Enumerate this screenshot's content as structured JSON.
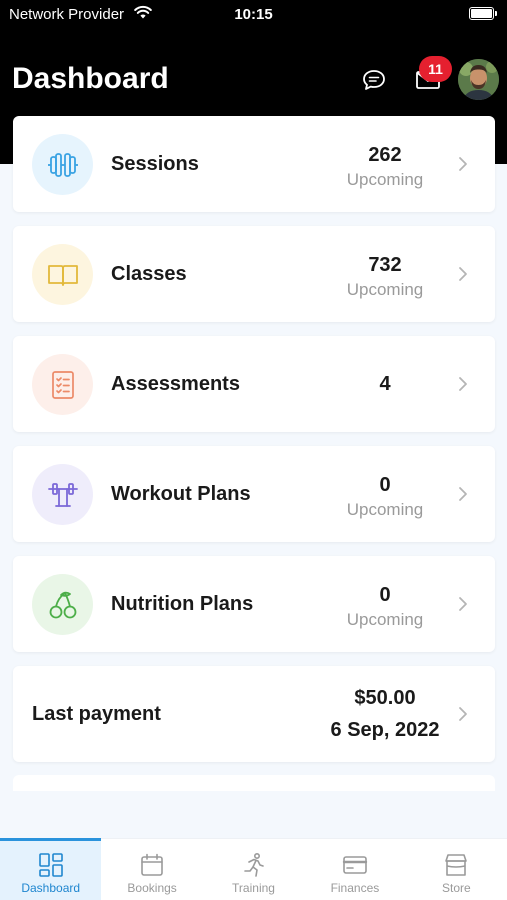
{
  "status_bar": {
    "carrier": "Network Provider",
    "time": "10:15"
  },
  "header": {
    "title": "Dashboard",
    "notification_count": "11",
    "chat_icon": "chat-bubble-icon",
    "mail_icon": "mail-icon"
  },
  "cards": [
    {
      "label": "Sessions",
      "value": "262",
      "sub": "Upcoming",
      "icon": "dumbbell-icon",
      "icon_bg": "#e6f4fd",
      "icon_color": "#3aa3e3"
    },
    {
      "label": "Classes",
      "value": "732",
      "sub": "Upcoming",
      "icon": "book-icon",
      "icon_bg": "#fdf5df",
      "icon_color": "#e2b93b"
    },
    {
      "label": "Assessments",
      "value": "4",
      "sub": "",
      "icon": "checklist-icon",
      "icon_bg": "#fdefea",
      "icon_color": "#ec8a68"
    },
    {
      "label": "Workout Plans",
      "value": "0",
      "sub": "Upcoming",
      "icon": "barbell-icon",
      "icon_bg": "#efedfb",
      "icon_color": "#7b68d8"
    },
    {
      "label": "Nutrition Plans",
      "value": "0",
      "sub": "Upcoming",
      "icon": "cherries-icon",
      "icon_bg": "#e9f6e7",
      "icon_color": "#4cae48"
    }
  ],
  "payment": {
    "label": "Last payment",
    "amount": "$50.00",
    "date": "6 Sep, 2022"
  },
  "tabs": [
    {
      "label": "Dashboard",
      "icon": "dashboard-icon",
      "active": true
    },
    {
      "label": "Bookings",
      "icon": "calendar-icon",
      "active": false
    },
    {
      "label": "Training",
      "icon": "running-icon",
      "active": false
    },
    {
      "label": "Finances",
      "icon": "credit-card-icon",
      "active": false
    },
    {
      "label": "Store",
      "icon": "store-icon",
      "active": false
    }
  ],
  "colors": {
    "header_bg": "#000000",
    "page_bg": "#f4f8fd",
    "accent": "#1f86cf",
    "badge": "#e5202f"
  }
}
